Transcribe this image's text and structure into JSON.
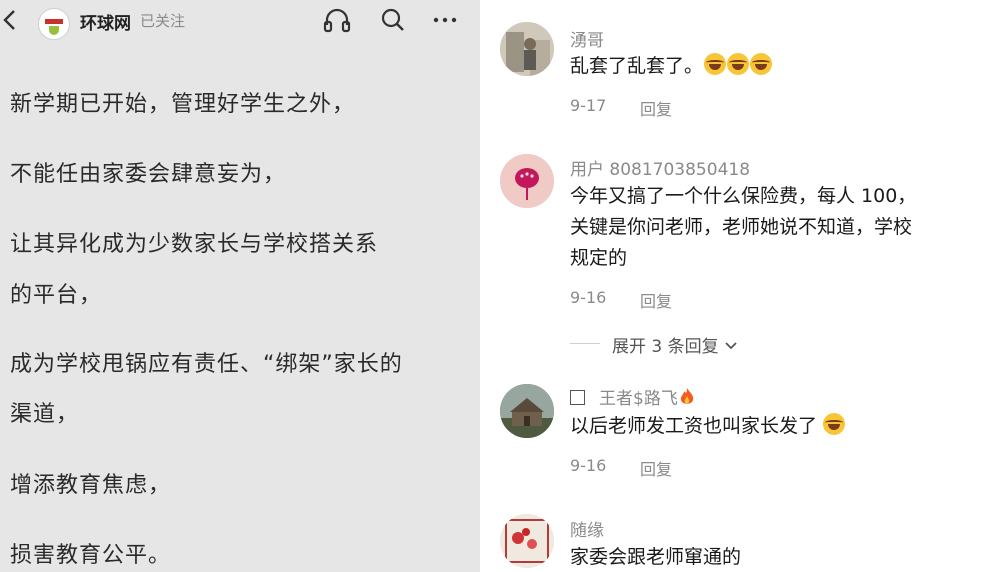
{
  "article_header": {
    "source_name": "环球网",
    "follow_status": "已关注"
  },
  "article": {
    "lines": [
      "新学期已开始，管理好学生之外，",
      "不能任由家委会肆意妄为，",
      "让其异化成为少数家长与学校搭关系",
      "的平台，",
      "成为学校甩锅应有责任、“绑架”家长的",
      "渠道，",
      "增添教育焦虑，",
      "损害教育公平。"
    ]
  },
  "comments": [
    {
      "username": "湧哥",
      "text": "乱套了乱套了。",
      "emojis": [
        "laughing-crying",
        "laughing-crying",
        "laughing-crying"
      ],
      "date": "9-17",
      "reply_label": "回复"
    },
    {
      "username": "用户 8081703850418",
      "text_lines": [
        "今年又搞了一个什么保险费，每人 100，",
        "关键是你问老师，老师她说不知道，学校",
        "规定的"
      ],
      "date": "9-16",
      "reply_label": "回复",
      "expand_label": "展开 3 条回复"
    },
    {
      "username": "王者$路飞",
      "text": "以后老师发工资也叫家长发了",
      "emojis": [
        "laughing-crying"
      ],
      "date": "9-16",
      "reply_label": "回复"
    },
    {
      "username": "随缘",
      "text": "家委会跟老师窜通的"
    }
  ],
  "colors": {
    "article_bg": "#e6e6e6",
    "meta_gray": "#8a8a8a",
    "emoji_yellow": "#f7c535"
  }
}
